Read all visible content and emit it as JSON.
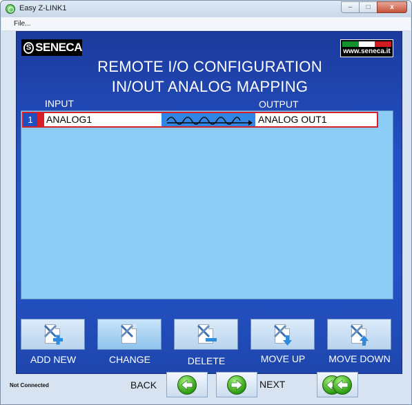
{
  "window": {
    "title": "Easy Z-LINK1",
    "controls": {
      "minimize": "–",
      "maximize": "□",
      "close": "x"
    }
  },
  "menu": {
    "file": "File..."
  },
  "brand": {
    "logo_text": "SENECA",
    "logo_mark": "S",
    "site": "www.seneca.it",
    "flag_colors": [
      "#14912c",
      "#ffffff",
      "#d11b21"
    ]
  },
  "header": {
    "line1": "REMOTE I/O CONFIGURATION",
    "line2": "IN/OUT ANALOG MAPPING"
  },
  "columns": {
    "input": "INPUT",
    "output": "OUTPUT"
  },
  "mappings": [
    {
      "index": "1",
      "input": "ANALOG1",
      "output": "ANALOG OUT1",
      "link_icon": "analog-wave-arrow-icon"
    }
  ],
  "actions": {
    "add_new": {
      "label": "ADD NEW",
      "icon": "tools-plus-icon"
    },
    "change": {
      "label": "CHANGE",
      "icon": "tools-icon"
    },
    "delete": {
      "label": "DELETE",
      "icon": "tools-minus-icon"
    },
    "move_up": {
      "label": "MOVE UP",
      "icon": "tools-arrow-down-icon"
    },
    "move_down": {
      "label": "MOVE DOWN",
      "icon": "tools-arrow-up-icon"
    }
  },
  "footer": {
    "status": "Not Connected",
    "back": "BACK",
    "next": "NEXT"
  },
  "colors": {
    "panel": "#2350c2",
    "list_bg": "#8ccdf5",
    "selection": "#d71d26",
    "nav_green": "#2d9d12"
  }
}
